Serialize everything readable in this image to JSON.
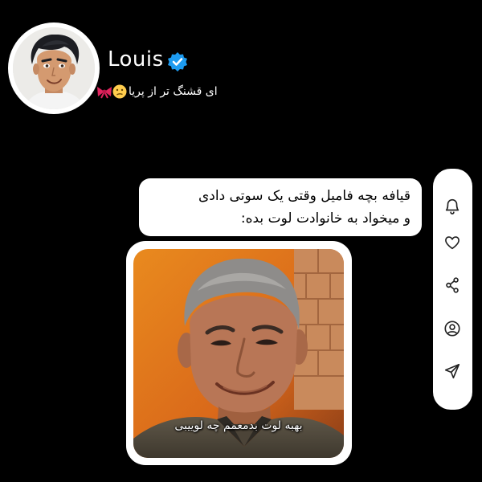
{
  "profile": {
    "username": "Louis",
    "verified": true,
    "bio": "ای قشنگ تر از پریا",
    "bio_emojis": [
      "confused-face-emoji",
      "ribbon-emoji"
    ],
    "avatar": "cartoon-man-avatar"
  },
  "post": {
    "text_lines": [
      "قیافه بچه فامیل وقتی یک سوتی دادی",
      "و میخواد به خانوادت لوت بده:"
    ],
    "image": {
      "subject": "smiling-man-photo",
      "caption": "بهبه لوت بدمعمم چه لوییبی"
    }
  },
  "actions": [
    {
      "name": "notification-bell-icon"
    },
    {
      "name": "like-heart-icon"
    },
    {
      "name": "share-icon"
    },
    {
      "name": "profile-icon"
    },
    {
      "name": "send-icon"
    }
  ],
  "colors": {
    "background": "#000000",
    "card": "#ffffff",
    "verified_badge": "#1d9bf0",
    "text_on_card": "#000000"
  }
}
